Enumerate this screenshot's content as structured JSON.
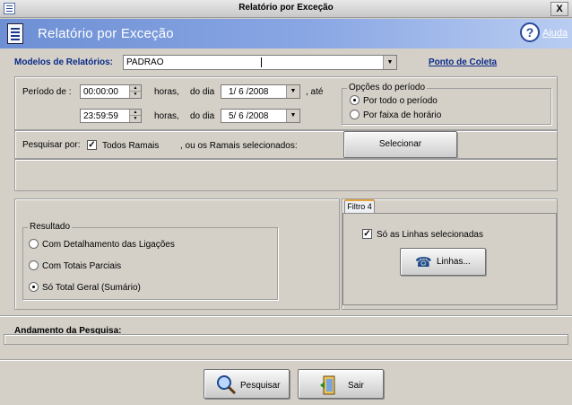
{
  "window": {
    "title": "Relatório por Exceção",
    "close_glyph": "X"
  },
  "header": {
    "title": "Relatório por Exceção",
    "help_label": "Ajuda",
    "help_icon": "question-icon",
    "doc_icon": "report-icon"
  },
  "models": {
    "label": "Modelos de Relatórios:",
    "value": "PADRAO",
    "link": "Ponto de Coleta"
  },
  "period": {
    "label": "Período de :",
    "start_time": "00:00:00",
    "end_time": "23:59:59",
    "hours_label": "horas,",
    "day_label": "do dia",
    "until_label": ", até",
    "start_date": "1/ 6 /2008",
    "end_date": "5/ 6 /2008"
  },
  "period_options": {
    "legend": "Opções do período",
    "options": [
      {
        "label": "Por todo o período",
        "selected": true
      },
      {
        "label": "Por faixa de horário",
        "selected": false
      }
    ]
  },
  "search": {
    "label": "Pesquisar por:",
    "all_extensions_label": "Todos Ramais",
    "all_extensions_checked": true,
    "selected_label": ", ou os Ramais selecionados:",
    "select_button": "Selecionar"
  },
  "result": {
    "legend": "Resultado",
    "options": [
      {
        "label": "Com Detalhamento das Ligações",
        "selected": false
      },
      {
        "label": "Com Totais  Parciais",
        "selected": false
      },
      {
        "label": "Só Total  Geral (Sumário)",
        "selected": true
      }
    ]
  },
  "filter": {
    "tab_label": "Filtro 4",
    "only_lines_label": "Só as Linhas selecionadas",
    "only_lines_checked": true,
    "lines_button": "Linhas...",
    "lines_icon": "telephone-icon"
  },
  "progress": {
    "label": "Andamento da Pesquisa:"
  },
  "actions": {
    "search_button": "Pesquisar",
    "search_icon": "magnifier-icon",
    "exit_button": "Sair",
    "exit_icon": "exit-door-icon"
  },
  "colors": {
    "banner_start": "#6d8fd4",
    "banner_end": "#b9cdf2",
    "label_blue": "#0a2a8a",
    "window_bg": "#d4d0c8"
  }
}
